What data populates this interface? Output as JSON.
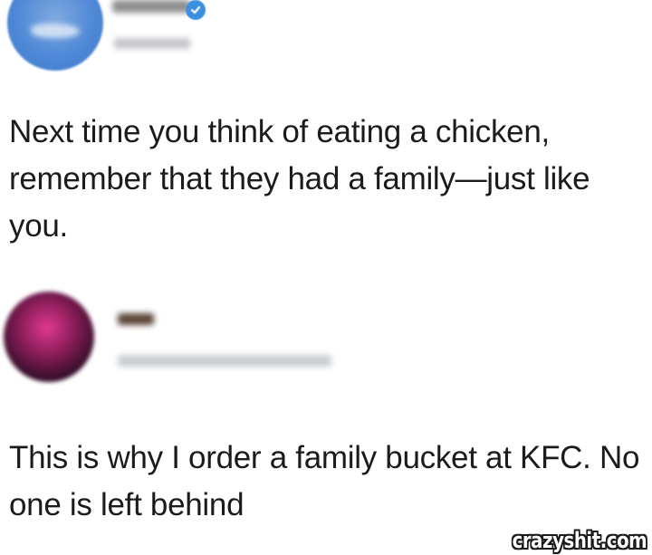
{
  "tweet_1": {
    "text": "Next time you think of eating a chicken, remember that they had a family—just like you.",
    "avatar_color": "#4e88d6",
    "verified_icon": "verified-check-icon",
    "verified_color": "#3b8fe0"
  },
  "tweet_2": {
    "text": "This is why I order a family bucket at KFC. No one is left behind",
    "avatar_color": "#8a1d5a"
  },
  "watermark": "crazyshit.com"
}
